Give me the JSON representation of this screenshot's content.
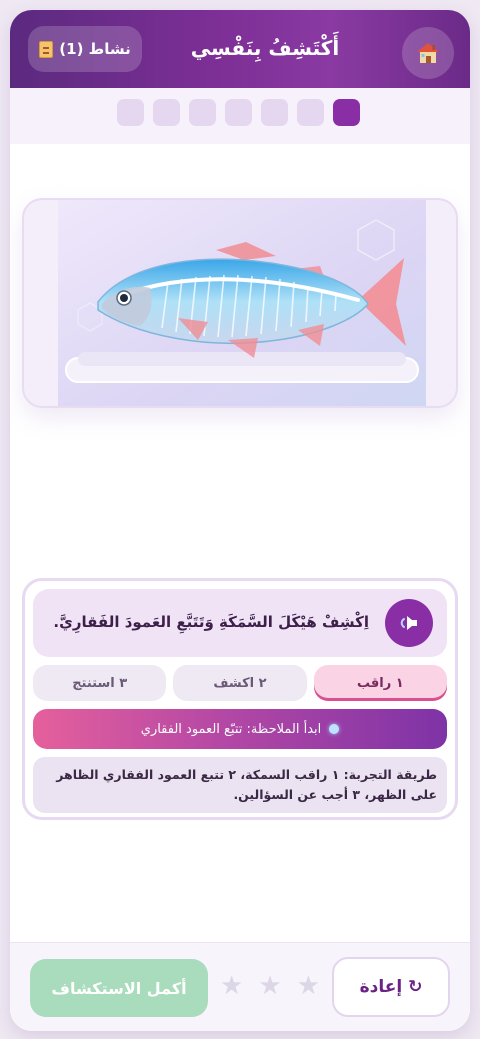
{
  "header": {
    "title": "أَكْتَشِفُ بِنَفْسِي",
    "activity_label": "نشاط (1)",
    "home_icon": "home-icon",
    "activity_icon": "document-icon"
  },
  "progress": {
    "total_steps": 7,
    "current_step": 1
  },
  "image": {
    "subject_icon": "fish-skeleton-illustration"
  },
  "instruction": {
    "text": "اِكْشِفْ هَيْكَلَ السَّمَكَةِ وَتَتَبَّعِ العَمودَ الفَقارِيَّ.",
    "speaker_icon": "speaker-icon"
  },
  "steps": [
    {
      "label": "١ راقب",
      "active": true
    },
    {
      "label": "٢ اكشف",
      "active": false
    },
    {
      "label": "٣ استنتج",
      "active": false
    }
  ],
  "hint": {
    "text": "ابدأ الملاحظة: تتبّع العمود الفقاري"
  },
  "method": {
    "text": "طريقة التجربة: ١ راقب السمكة، ٢ تتبع العمود الفقاري الظاهر على الظهر، ٣ أجب عن السؤالين."
  },
  "footer": {
    "redo_label": "↻ إعادة",
    "finish_label": "أكمل الاستكشاف",
    "stars_total": 3,
    "stars_earned": 0
  },
  "colors": {
    "primary": "#8a2ea6",
    "finish_disabled": "#a9dbbd",
    "step_active": "#fad3e5"
  }
}
